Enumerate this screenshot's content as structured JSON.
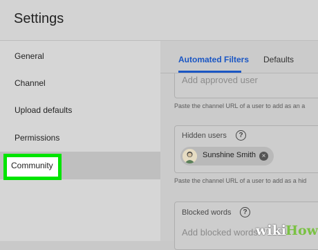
{
  "header": {
    "title": "Settings"
  },
  "sidebar": {
    "items": [
      {
        "label": "General"
      },
      {
        "label": "Channel"
      },
      {
        "label": "Upload defaults"
      },
      {
        "label": "Permissions"
      },
      {
        "label": "Community",
        "selected": true
      }
    ]
  },
  "tabs": [
    {
      "label": "Automated Filters",
      "active": true
    },
    {
      "label": "Defaults"
    }
  ],
  "approved_users": {
    "placeholder": "Add approved user",
    "help": "Paste the channel URL of a user to add as an a"
  },
  "hidden_users": {
    "label": "Hidden users",
    "chip_name": "Sunshine Smith",
    "help": "Paste the channel URL of a user to add as a hid"
  },
  "blocked_words": {
    "label": "Blocked words",
    "placeholder": "Add blocked words"
  },
  "watermark": {
    "wiki": "wiki",
    "how": "How"
  },
  "colors": {
    "accent": "#1a56c4",
    "highlight": "#00e400",
    "watermark_green": "#7ac143"
  }
}
